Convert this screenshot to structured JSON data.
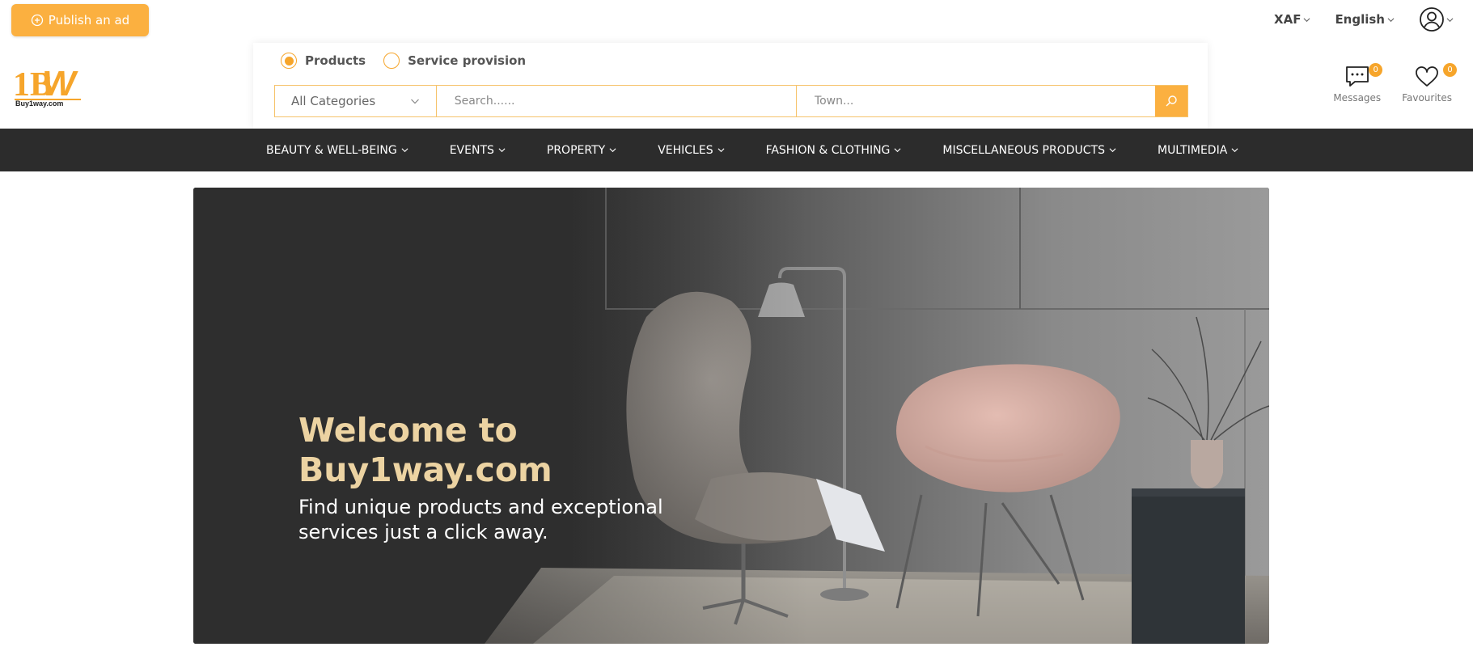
{
  "header": {
    "publish_label": "Publish an ad",
    "currency": "XAF",
    "language": "English"
  },
  "logo": {
    "mark": "1BW",
    "domain": "Buy1way.com"
  },
  "search": {
    "type_options": [
      {
        "label": "Products",
        "selected": true
      },
      {
        "label": "Service provision",
        "selected": false
      }
    ],
    "category_selected": "All Categories",
    "keyword_placeholder": "Search......",
    "town_placeholder": "Town..."
  },
  "header_icons": {
    "messages": {
      "label": "Messages",
      "count": "0"
    },
    "favourites": {
      "label": "Favourites",
      "count": "0"
    }
  },
  "nav": {
    "items": [
      "BEAUTY & WELL-BEING",
      "EVENTS",
      "PROPERTY",
      "VEHICLES",
      "FASHION & CLOTHING",
      "MISCELLANEOUS PRODUCTS",
      "MULTIMEDIA"
    ]
  },
  "hero": {
    "title": "Welcome to Buy1way.com",
    "subtitle": "Find unique products and exceptional services just a click away."
  },
  "colors": {
    "accent": "#fbb040",
    "nav_bg": "#2c2c2c",
    "hero_title": "#ecd3a2"
  }
}
